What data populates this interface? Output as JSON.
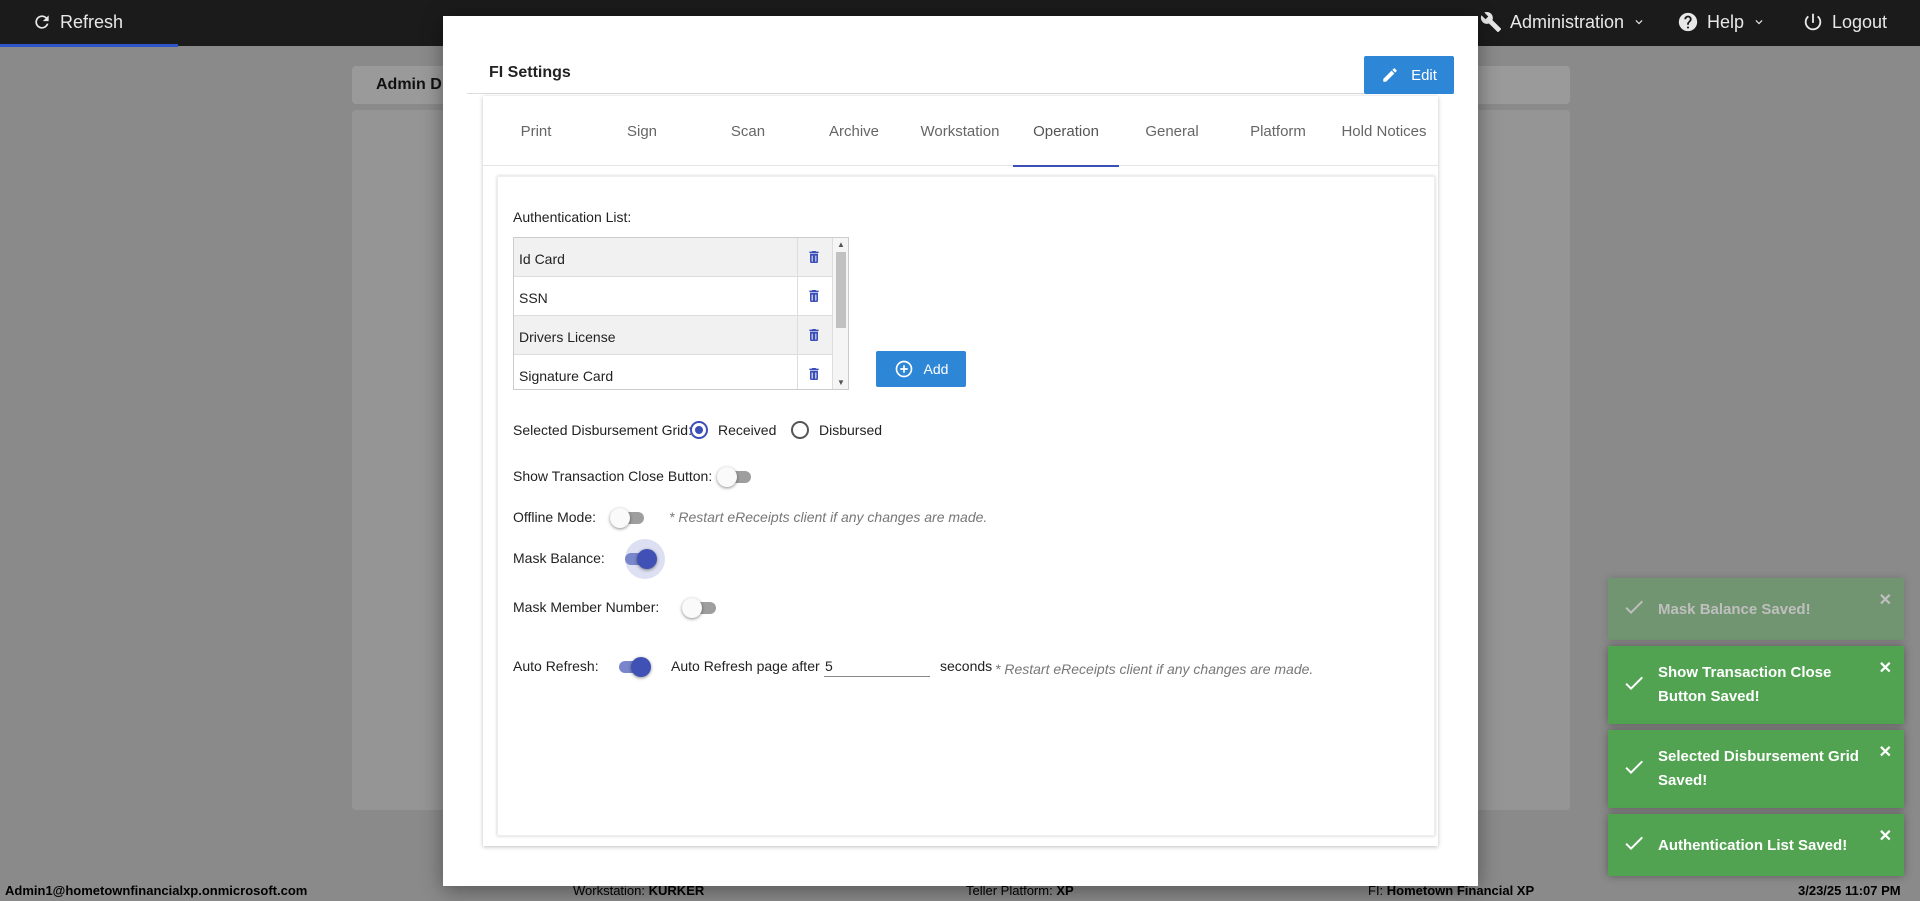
{
  "topbar": {
    "refresh_label": "Refresh",
    "administration_label": "Administration",
    "help_label": "Help",
    "logout_label": "Logout"
  },
  "background": {
    "panel_title": "Admin D"
  },
  "modal": {
    "title": "FI Settings",
    "edit_label": "Edit",
    "tabs": [
      "Print",
      "Sign",
      "Scan",
      "Archive",
      "Workstation",
      "Operation",
      "General",
      "Platform",
      "Hold Notices"
    ],
    "active_tab": "Operation",
    "operation": {
      "auth_list_label": "Authentication List:",
      "auth_items": [
        "Id Card",
        "SSN",
        "Drivers License",
        "Signature Card"
      ],
      "add_label": "Add",
      "disbursement_label": "Selected Disbursement Grid:",
      "radio_received": "Received",
      "radio_disbursed": "Disbursed",
      "selected_grid": "Received",
      "show_close_label": "Show Transaction Close Button:",
      "offline_label": "Offline Mode:",
      "restart_note": "* Restart eReceipts client if any changes are made.",
      "mask_balance_label": "Mask Balance:",
      "mask_member_label": "Mask Member Number:",
      "auto_refresh_label": "Auto Refresh:",
      "auto_refresh_after": "Auto Refresh page after",
      "auto_refresh_value": "5",
      "seconds_label": "seconds"
    }
  },
  "statusbar": {
    "user": "Admin1@hometownfinancialxp.onmicrosoft.com",
    "workstation_label": "Workstation:",
    "workstation_value": "KURKER",
    "platform_label": "Teller Platform:",
    "platform_value": "XP",
    "fi_label": "FI:",
    "fi_value": "Hometown Financial XP",
    "datetime": "3/23/25 11:07 PM"
  },
  "toasts": [
    "Mask Balance Saved!",
    "Show Transaction Close Button Saved!",
    "Selected Disbursement Grid Saved!",
    "Authentication List Saved!"
  ],
  "colors": {
    "primary_button": "#2e86d6",
    "accent": "#3f51b5",
    "toast_success": "#51a351"
  }
}
